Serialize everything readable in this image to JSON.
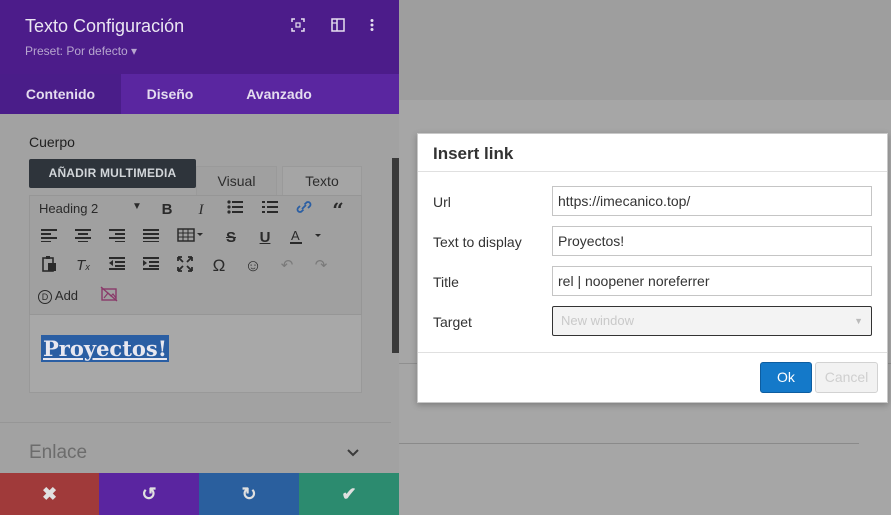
{
  "panel": {
    "title": "Texto Configuración",
    "preset": "Preset: Por defecto ▾",
    "header_icons": [
      "expand-icon",
      "split-view-icon",
      "more-vertical-icon"
    ],
    "tabs": [
      {
        "label": "Contenido",
        "active": true
      },
      {
        "label": "Diseño",
        "active": false
      },
      {
        "label": "Avanzado",
        "active": false
      }
    ],
    "section_label": "Cuerpo",
    "media_button": "AÑADIR MULTIMEDIA",
    "editor_tabs": {
      "visual": "Visual",
      "texto": "Texto"
    },
    "toolbar": {
      "heading_select": "Heading 2",
      "add_label": "Add"
    },
    "content_text": "Proyectos!",
    "enlace_label": "Enlace"
  },
  "footer": {
    "cancel": "✖",
    "undo": "↺",
    "redo": "↻",
    "save": "✔"
  },
  "dialog": {
    "title": "Insert link",
    "url_label": "Url",
    "url_value": "https://imecanico.top/",
    "text_label": "Text to display",
    "text_value": "Proyectos!",
    "title_label": "Title",
    "title_value": "rel | noopener noreferrer",
    "target_label": "Target",
    "target_value": "New window",
    "ok_label": "Ok",
    "cancel_label": "Cancel"
  },
  "colors": {
    "header_purple": "#4c1c8a",
    "tab_purple": "#5a26a0",
    "ok_blue": "#1479c9",
    "footer_red": "#a03a3a",
    "footer_green": "#2c8b6f",
    "footer_blue": "#2a5f9e"
  }
}
